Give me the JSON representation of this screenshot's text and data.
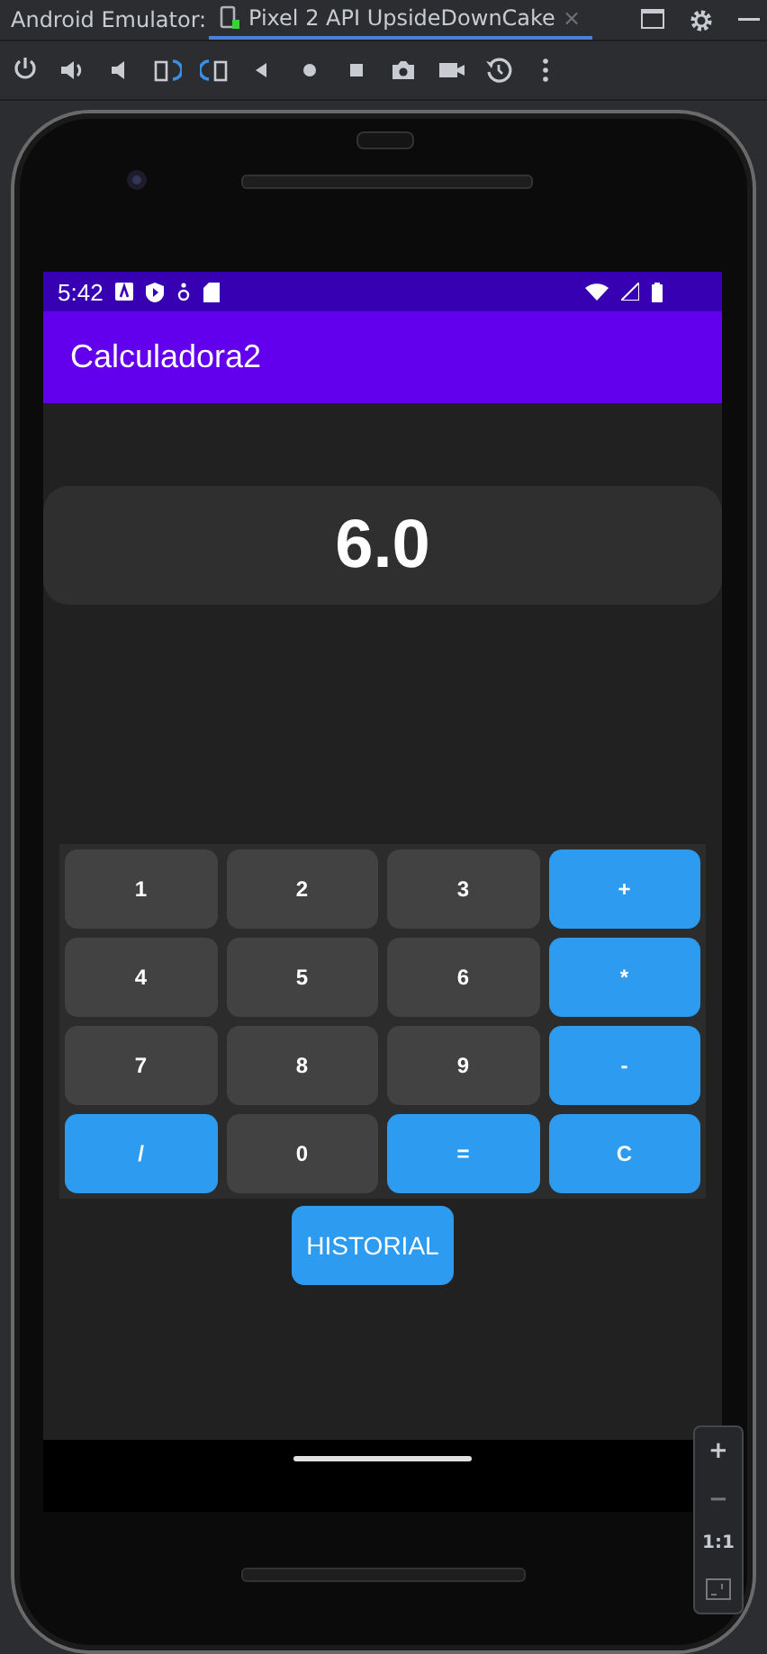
{
  "ide": {
    "label": "Android Emulator:",
    "tab": {
      "title": "Pixel 2 API UpsideDownCake",
      "selected": true,
      "close": "×"
    }
  },
  "status_bar": {
    "time": "5:42"
  },
  "app_bar": {
    "title": "Calculadora2"
  },
  "display": {
    "value": "6.0"
  },
  "keypad": [
    {
      "label": "1",
      "kind": "digit"
    },
    {
      "label": "2",
      "kind": "digit"
    },
    {
      "label": "3",
      "kind": "digit"
    },
    {
      "label": "+",
      "kind": "operator"
    },
    {
      "label": "4",
      "kind": "digit"
    },
    {
      "label": "5",
      "kind": "digit"
    },
    {
      "label": "6",
      "kind": "digit"
    },
    {
      "label": "*",
      "kind": "operator"
    },
    {
      "label": "7",
      "kind": "digit"
    },
    {
      "label": "8",
      "kind": "digit"
    },
    {
      "label": "9",
      "kind": "digit"
    },
    {
      "label": "-",
      "kind": "operator"
    },
    {
      "label": "/",
      "kind": "operator"
    },
    {
      "label": "0",
      "kind": "digit"
    },
    {
      "label": "=",
      "kind": "operator"
    },
    {
      "label": "C",
      "kind": "operator"
    }
  ],
  "history_button": {
    "label": "HISTORIAL"
  },
  "zoom_controls": {
    "plus": "+",
    "minus": "−",
    "actual_size": "1:1"
  }
}
